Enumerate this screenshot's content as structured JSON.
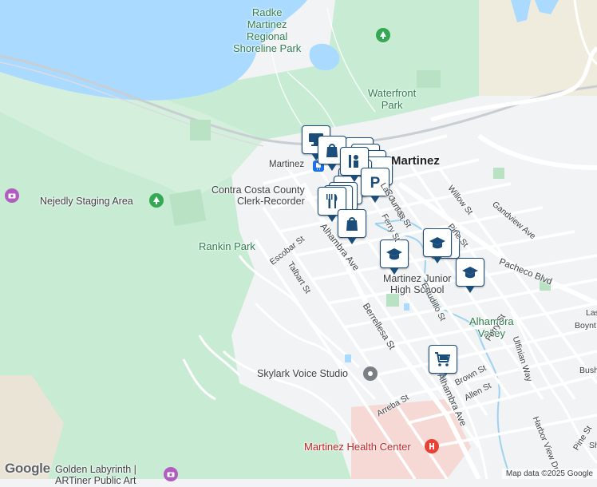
{
  "map": {
    "colors": {
      "water": "#aadaff",
      "park": "#c8ebd4",
      "urban": "#f1f3f4",
      "road": "#ffffff",
      "pin_border": "#1a4d7a"
    },
    "labels": {
      "radke": "Radke\nMartinez\nRegional\nShoreline Park",
      "waterfront": "Waterfront\nPark",
      "nejedly": "Nejedly Staging Area",
      "rankin": "Rankin Park",
      "martinez_city": "Martinez",
      "martinez_station": "Martinez",
      "contra_costa": "Contra Costa County\nClerk-Recorder",
      "martinez_jhs": "Martinez Junior\nHigh School",
      "alhambra_valley": "Alhambra\nValley",
      "skylark": "Skylark Voice Studio",
      "health": "Martinez Health Center",
      "golden": "Golden Labyrinth |\nARTiner Public Art"
    },
    "streets": {
      "court": "Court St",
      "willow": "Willow St",
      "grandview": "Gandview Ave",
      "pine": "Pine St",
      "pacheco": "Pacheco Blvd",
      "escobar": "Escobar St",
      "talbart": "Talbart St",
      "alhambra": "Alhambra Ave",
      "alhambra2": "Alhambra Ave",
      "berrellesa": "Berrellesa St",
      "estudillo": "Estudillo St",
      "ferry": "Ferry St",
      "ferry2": "Ferry St",
      "juntas": "Las Juntas St",
      "ward": "Ward St",
      "brown": "Brown St",
      "allen": "Allen St",
      "arreba": "Arreba St",
      "ulfinian": "Ulfinian Way",
      "harbor": "Harbor View Dr",
      "las": "Las",
      "boyn": "Boynt",
      "bush": "Bush",
      "pine2": "Pine St",
      "sh": "Sh"
    },
    "icons": [
      "food-marker-icon",
      "shopping-bag-marker-icon",
      "parking-marker-icon",
      "school-marker-icon",
      "grocery-cart-marker-icon",
      "transit-marker-icon",
      "government-marker-icon",
      "tree-icon",
      "camera-icon",
      "hospital-icon"
    ],
    "attribution": "Map data ©2025 Google",
    "brand": "Google"
  }
}
